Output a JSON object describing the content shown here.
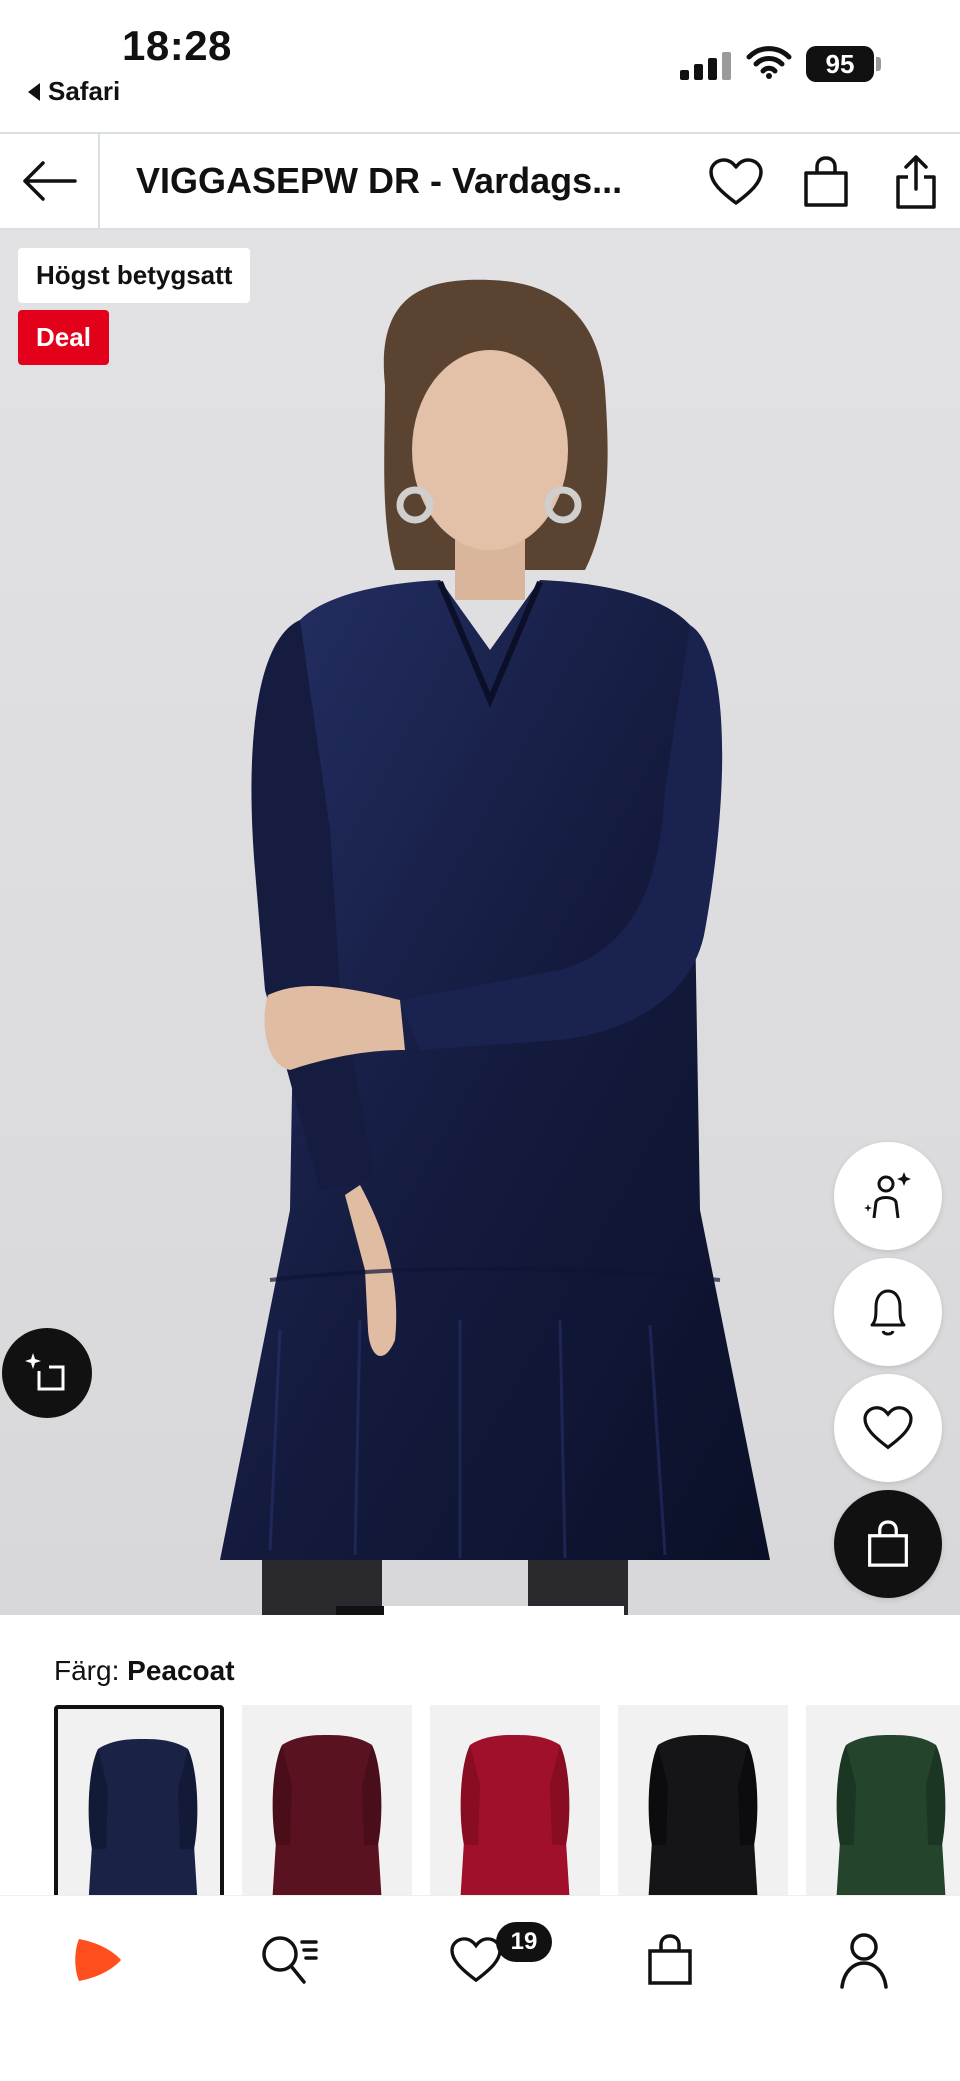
{
  "status_bar": {
    "time": "18:28",
    "back_app": "Safari",
    "battery": "95"
  },
  "nav": {
    "title": "VIGGASEPW DR - Vardags..."
  },
  "hero": {
    "badge_top": "Högst betygsatt",
    "badge_deal": "Deal",
    "deal_color": "#e2001a"
  },
  "color": {
    "label": "Färg:",
    "selected": "Peacoat",
    "swatches": [
      {
        "color": "#1a2245",
        "selected": true
      },
      {
        "color": "#5a1220",
        "selected": false
      },
      {
        "color": "#a0102a",
        "selected": false
      },
      {
        "color": "#151518",
        "selected": false
      },
      {
        "color": "#24452c",
        "selected": false
      }
    ]
  },
  "tab_bar": {
    "wishlist_count": "19",
    "accent": "#ff4f1f"
  }
}
